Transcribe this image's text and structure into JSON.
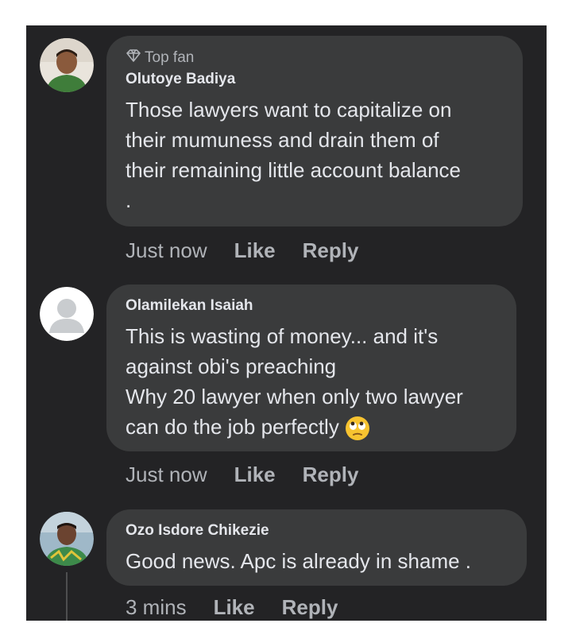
{
  "comments": [
    {
      "badge": "Top fan",
      "badge_icon": "diamond-icon",
      "author": "Olutoye Badiya",
      "text": "Those lawyers want to capitalize on\ntheir mumuness and drain them of\ntheir remaining little account balance\n.",
      "time": "Just now",
      "like": "Like",
      "reply": "Reply"
    },
    {
      "author": "Olamilekan Isaiah",
      "text": "This is wasting of money... and it's\nagainst obi's preaching\nWhy 20 lawyer when only two lawyer\ncan do the job perfectly",
      "emoji": "face-with-rolling-eyes-emoji",
      "time": "Just now",
      "like": "Like",
      "reply": "Reply"
    },
    {
      "author": "Ozo Isdore Chikezie",
      "text": "Good news. Apc is already in shame .",
      "time": "3 mins",
      "like": "Like",
      "reply": "Reply"
    }
  ],
  "colors": {
    "background": "#232325",
    "bubble": "#3a3b3c",
    "text": "#e4e6eb",
    "muted": "#b0b3b8"
  }
}
